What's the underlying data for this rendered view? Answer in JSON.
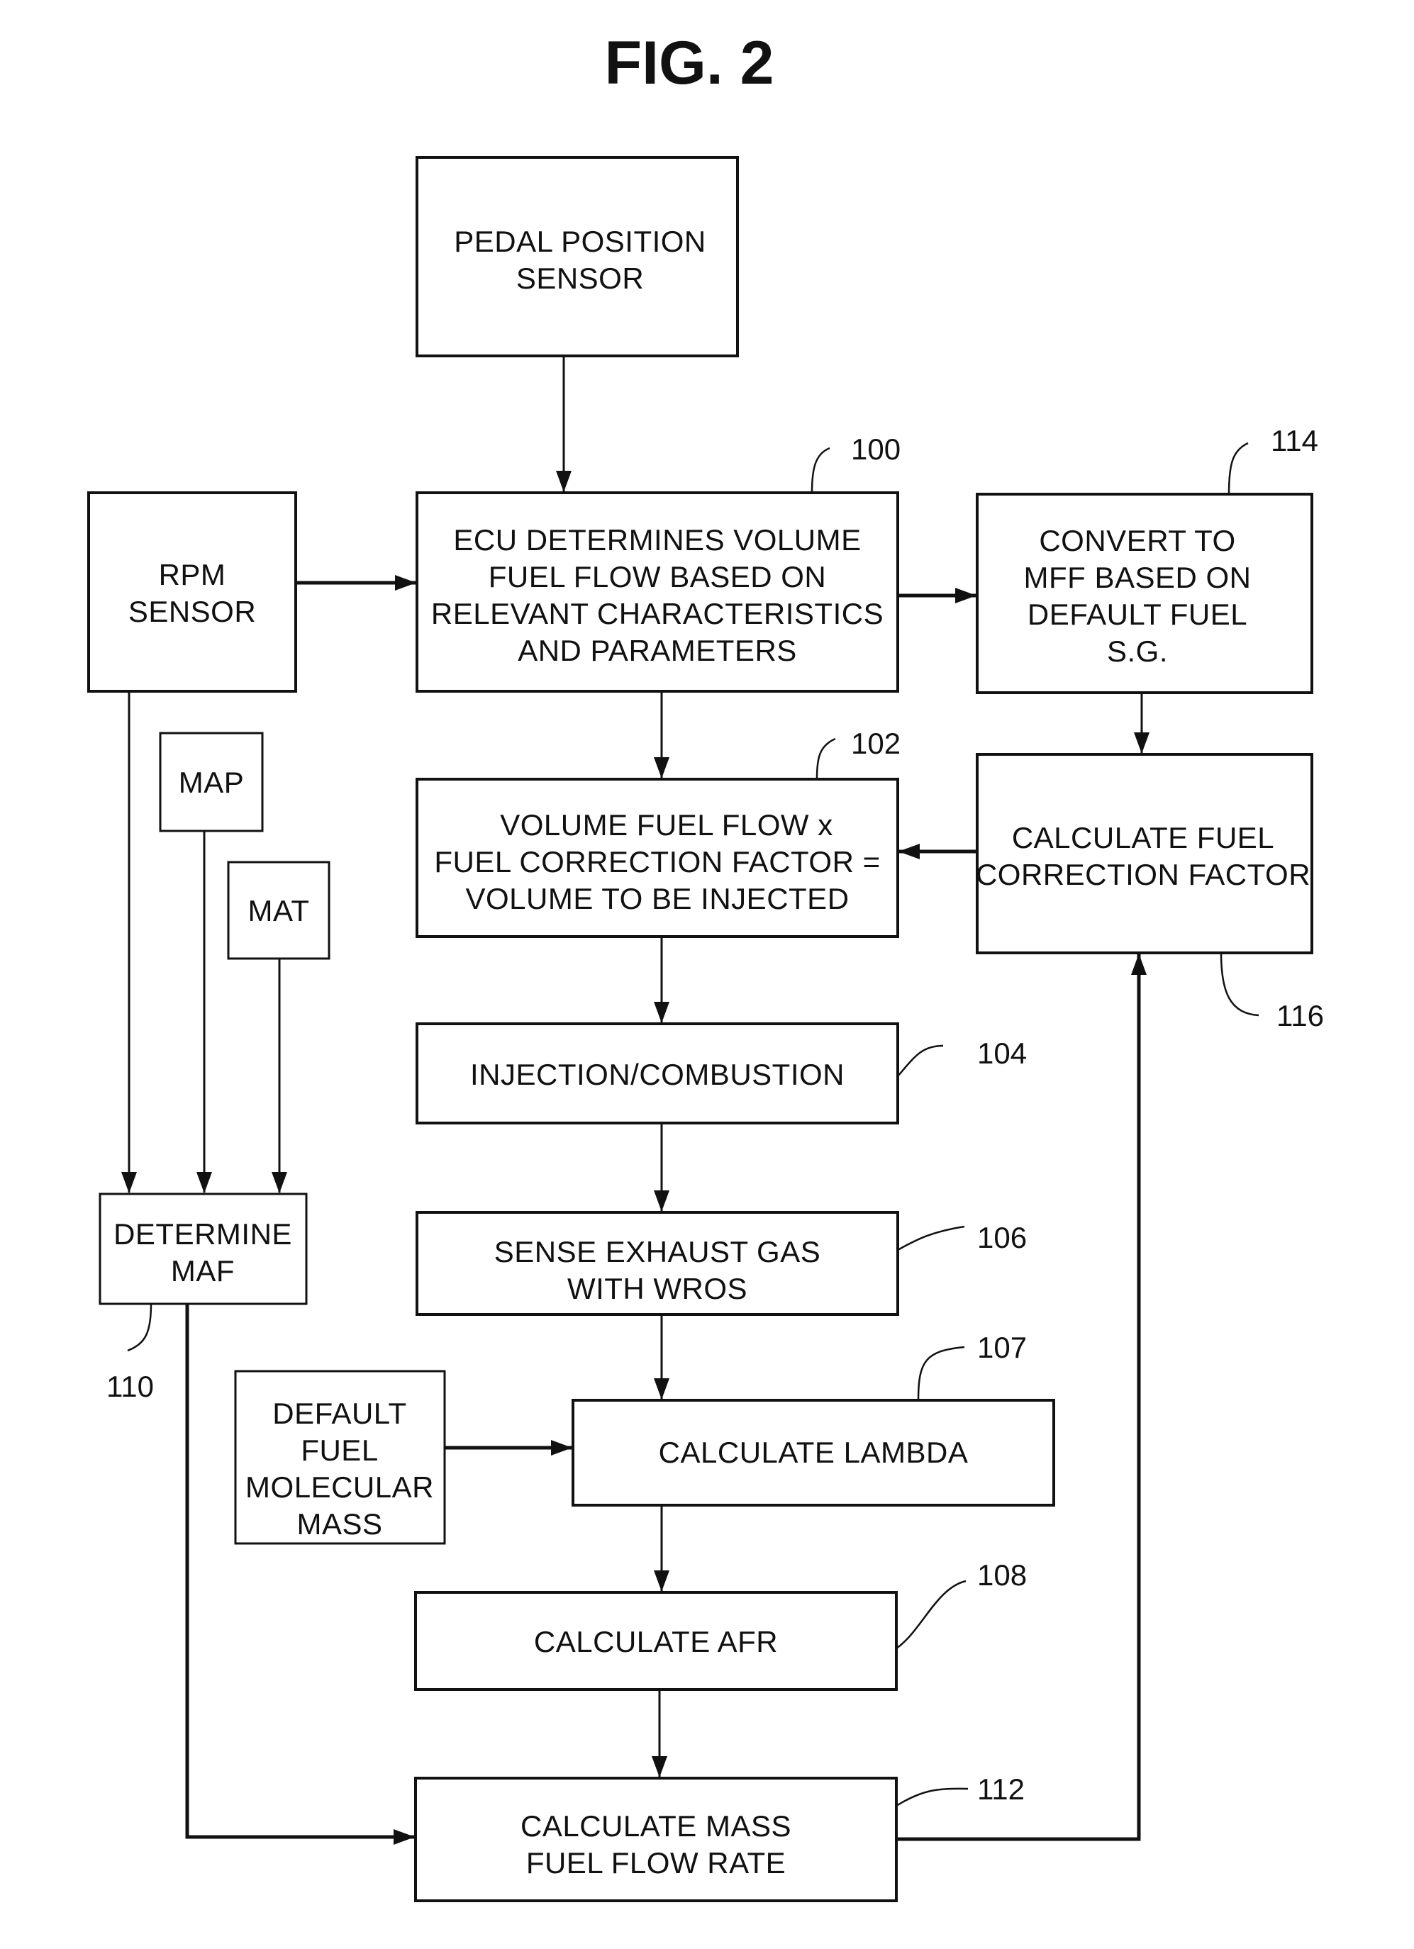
{
  "figure": {
    "title": "FIG. 2"
  },
  "blocks": {
    "pedal": {
      "lines": [
        "PEDAL POSITION",
        "SENSOR"
      ]
    },
    "rpm": {
      "lines": [
        "RPM",
        "SENSOR"
      ]
    },
    "ecu": {
      "ref": "100",
      "lines": [
        "ECU DETERMINES VOLUME",
        "FUEL FLOW BASED ON",
        "RELEVANT CHARACTERISTICS",
        "AND PARAMETERS"
      ]
    },
    "convert": {
      "ref": "114",
      "lines": [
        "CONVERT TO",
        "MFF BASED ON",
        "DEFAULT FUEL",
        "S.G."
      ]
    },
    "map": {
      "lines": [
        "MAP"
      ]
    },
    "mat": {
      "lines": [
        "MAT"
      ]
    },
    "volume": {
      "ref": "102",
      "lines": [
        "VOLUME FUEL FLOW x",
        "FUEL CORRECTION FACTOR =",
        "VOLUME TO BE INJECTED"
      ]
    },
    "correction": {
      "ref": "116",
      "lines": [
        "CALCULATE FUEL",
        "CORRECTION FACTOR"
      ]
    },
    "injection": {
      "ref": "104",
      "lines": [
        "INJECTION/COMBUSTION"
      ]
    },
    "maf": {
      "ref": "110",
      "lines": [
        "DETERMINE",
        "MAF"
      ]
    },
    "sense": {
      "ref": "106",
      "lines": [
        "SENSE EXHAUST GAS",
        "WITH WROS"
      ]
    },
    "default_fuel": {
      "lines": [
        "DEFAULT",
        "FUEL",
        "MOLECULAR",
        "MASS"
      ]
    },
    "lambda": {
      "ref": "107",
      "lines": [
        "CALCULATE LAMBDA"
      ]
    },
    "afr": {
      "ref": "108",
      "lines": [
        "CALCULATE AFR"
      ]
    },
    "mass": {
      "ref": "112",
      "lines": [
        "CALCULATE MASS",
        "FUEL FLOW RATE"
      ]
    }
  },
  "colors": {
    "ink": "#111111",
    "background": "#ffffff"
  }
}
